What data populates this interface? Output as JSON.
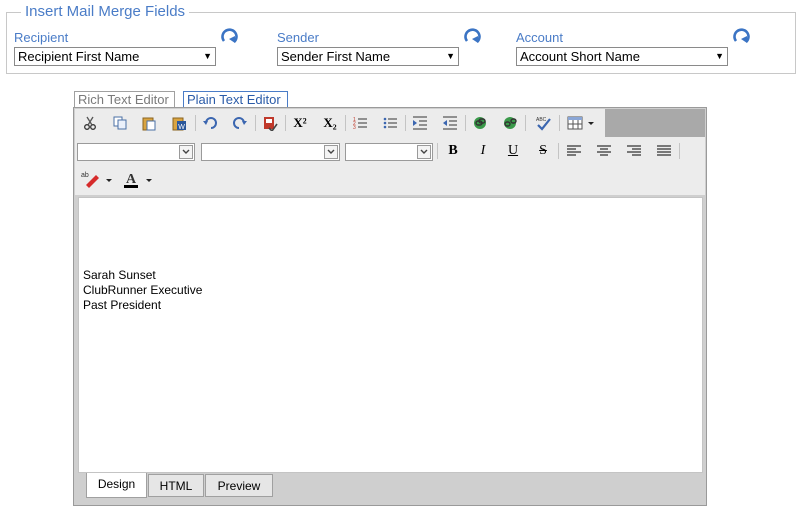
{
  "merge_fields": {
    "legend": "Insert Mail Merge Fields",
    "recipient": {
      "label": "Recipient",
      "value": "Recipient First Name"
    },
    "sender": {
      "label": "Sender",
      "value": "Sender First Name"
    },
    "account": {
      "label": "Account",
      "value": "Account Short Name"
    }
  },
  "editor_modes": [
    "Rich Text Editor",
    "Plain Text Editor"
  ],
  "active_mode": "Plain Text Editor",
  "toolbar": {
    "row1": [
      "cut-icon",
      "copy-icon",
      "paste-icon",
      "paste-from-word-icon",
      "undo-icon",
      "redo-icon",
      "spellcheck-icon",
      "superscript-icon",
      "subscript-icon",
      "ordered-list-icon",
      "unordered-list-icon",
      "indent-icon",
      "outdent-icon",
      "insert-link-icon",
      "remove-link-icon",
      "spelling-check-abc-icon",
      "insert-table-icon"
    ],
    "superscript_label": "X²",
    "subscript_label": "X₂",
    "format_buttons": {
      "bold": "B",
      "italic": "I",
      "underline": "U",
      "strikethrough": "S"
    },
    "highlight_label": "ab",
    "font_color_label": "A",
    "colors": {
      "accent": "#4a7cc7",
      "font_color": "#000000",
      "highlight": "#d62b2b"
    }
  },
  "content": {
    "lines": [
      "Sarah Sunset",
      "ClubRunner Executive",
      "Past President"
    ]
  },
  "view_tabs": [
    "Design",
    "HTML",
    "Preview"
  ],
  "active_view": "Design"
}
